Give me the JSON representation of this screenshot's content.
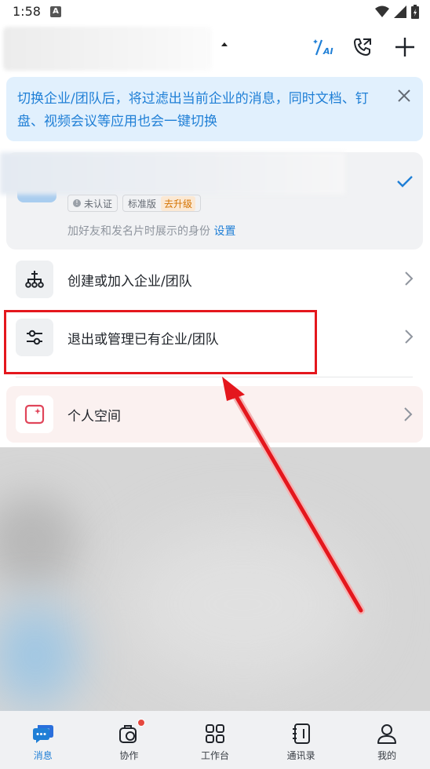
{
  "status_bar": {
    "time": "1:58",
    "a_icon": "A"
  },
  "notice": {
    "text": "切换企业/团队后，将过滤出当前企业的消息，同时文档、钉盘、视频会议等应用也会一键切换"
  },
  "org_card": {
    "tag_unverified": "未认证",
    "tag_edition": "标准版",
    "tag_upgrade": "去升级",
    "identity_text": "加好友和发名片时展示的身份",
    "identity_link": "设置"
  },
  "menu": {
    "create_join": "创建或加入企业/团队",
    "exit_manage": "退出或管理已有企业/团队",
    "personal_space": "个人空间"
  },
  "bottom_nav": {
    "items": [
      {
        "label": "消息",
        "icon": "message-icon"
      },
      {
        "label": "协作",
        "icon": "collaboration-icon"
      },
      {
        "label": "工作台",
        "icon": "workbench-icon"
      },
      {
        "label": "通讯录",
        "icon": "contacts-icon"
      },
      {
        "label": "我的",
        "icon": "profile-icon"
      }
    ]
  },
  "colors": {
    "accent": "#1f7fd6",
    "notice_bg": "#e1f0fd",
    "annotation": "#e4171d",
    "badge": "#e5483e"
  }
}
